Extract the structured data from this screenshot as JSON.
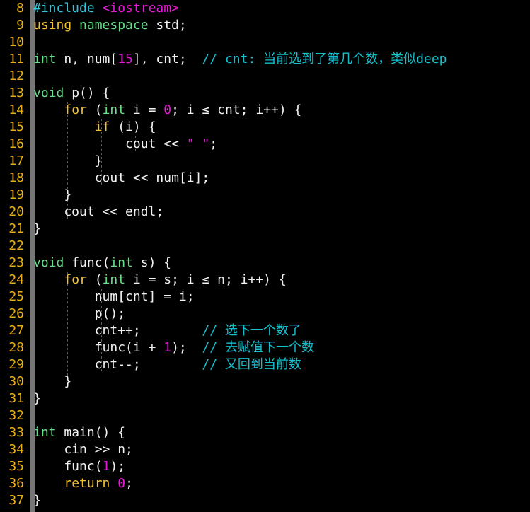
{
  "editor": {
    "language": "cpp",
    "background_color": "#000000",
    "line_number_color": "#e8b012",
    "block_marker_color": "#767676",
    "first_visible_line": 8,
    "last_visible_line": 37,
    "colors": {
      "preprocessor": "#2fc7e0",
      "header": "#e418d6",
      "keyword": "#f2c12e",
      "type": "#66e08c",
      "number": "#e418d6",
      "string": "#e418d6",
      "plain": "#f2f2f2",
      "comment": "#12c0cf"
    }
  },
  "lines": [
    {
      "number": "8",
      "tokens": [
        {
          "t": "#include",
          "c": "tk-pre"
        },
        {
          "t": " ",
          "c": "tk-plain"
        },
        {
          "t": "<iostream>",
          "c": "tk-hdr"
        }
      ],
      "guides": []
    },
    {
      "number": "9",
      "tokens": [
        {
          "t": "using",
          "c": "tk-kw"
        },
        {
          "t": " ",
          "c": "tk-plain"
        },
        {
          "t": "namespace",
          "c": "tk-type"
        },
        {
          "t": " std;",
          "c": "tk-plain"
        }
      ],
      "guides": []
    },
    {
      "number": "10",
      "tokens": [],
      "guides": []
    },
    {
      "number": "11",
      "tokens": [
        {
          "t": "int",
          "c": "tk-type"
        },
        {
          "t": " n, num[",
          "c": "tk-plain"
        },
        {
          "t": "15",
          "c": "tk-num"
        },
        {
          "t": "], cnt;  ",
          "c": "tk-plain"
        },
        {
          "t": "// cnt: 当前选到了第几个数，类似deep",
          "c": "tk-cmt"
        }
      ],
      "guides": []
    },
    {
      "number": "12",
      "tokens": [],
      "guides": []
    },
    {
      "number": "13",
      "tokens": [
        {
          "t": "void",
          "c": "tk-type"
        },
        {
          "t": " p() {",
          "c": "tk-plain"
        }
      ],
      "guides": []
    },
    {
      "number": "14",
      "tokens": [
        {
          "t": "    ",
          "c": "tk-plain"
        },
        {
          "t": "for",
          "c": "tk-kw"
        },
        {
          "t": " (",
          "c": "tk-plain"
        },
        {
          "t": "int",
          "c": "tk-type"
        },
        {
          "t": " i = ",
          "c": "tk-plain"
        },
        {
          "t": "0",
          "c": "tk-num"
        },
        {
          "t": "; i ≤ cnt; i++) {",
          "c": "tk-plain"
        }
      ],
      "guides": [
        95
      ]
    },
    {
      "number": "15",
      "tokens": [
        {
          "t": "        ",
          "c": "tk-plain"
        },
        {
          "t": "if",
          "c": "tk-kw"
        },
        {
          "t": " (i) {",
          "c": "tk-plain"
        }
      ],
      "guides": [
        95,
        143
      ]
    },
    {
      "number": "16",
      "tokens": [
        {
          "t": "            cout << ",
          "c": "tk-plain"
        },
        {
          "t": "\" \"",
          "c": "tk-str"
        },
        {
          "t": ";",
          "c": "tk-plain"
        }
      ],
      "guides": [
        95,
        143,
        191
      ]
    },
    {
      "number": "17",
      "tokens": [
        {
          "t": "        }",
          "c": "tk-plain"
        }
      ],
      "guides": [
        95,
        143
      ]
    },
    {
      "number": "18",
      "tokens": [
        {
          "t": "        cout << num[i];",
          "c": "tk-plain"
        }
      ],
      "guides": [
        95,
        143
      ]
    },
    {
      "number": "19",
      "tokens": [
        {
          "t": "    }",
          "c": "tk-plain"
        }
      ],
      "guides": [
        95
      ]
    },
    {
      "number": "20",
      "tokens": [
        {
          "t": "    cout << endl;",
          "c": "tk-plain"
        }
      ],
      "guides": [
        95
      ]
    },
    {
      "number": "21",
      "tokens": [
        {
          "t": "}",
          "c": "tk-plain"
        }
      ],
      "guides": []
    },
    {
      "number": "22",
      "tokens": [],
      "guides": []
    },
    {
      "number": "23",
      "tokens": [
        {
          "t": "void",
          "c": "tk-type"
        },
        {
          "t": " func(",
          "c": "tk-plain"
        },
        {
          "t": "int",
          "c": "tk-type"
        },
        {
          "t": " s) {",
          "c": "tk-plain"
        }
      ],
      "guides": []
    },
    {
      "number": "24",
      "tokens": [
        {
          "t": "    ",
          "c": "tk-plain"
        },
        {
          "t": "for",
          "c": "tk-kw"
        },
        {
          "t": " (",
          "c": "tk-plain"
        },
        {
          "t": "int",
          "c": "tk-type"
        },
        {
          "t": " i = s; i ≤ n; i++) {",
          "c": "tk-plain"
        }
      ],
      "guides": [
        95
      ]
    },
    {
      "number": "25",
      "tokens": [
        {
          "t": "        num[cnt] = i;",
          "c": "tk-plain"
        }
      ],
      "guides": [
        95,
        143
      ]
    },
    {
      "number": "26",
      "tokens": [
        {
          "t": "        p();",
          "c": "tk-plain"
        }
      ],
      "guides": [
        95,
        143
      ]
    },
    {
      "number": "27",
      "tokens": [
        {
          "t": "        cnt++;        ",
          "c": "tk-plain"
        },
        {
          "t": "// 选下一个数了",
          "c": "tk-cmt"
        }
      ],
      "guides": [
        95,
        143
      ]
    },
    {
      "number": "28",
      "tokens": [
        {
          "t": "        func(i + ",
          "c": "tk-plain"
        },
        {
          "t": "1",
          "c": "tk-num"
        },
        {
          "t": ");  ",
          "c": "tk-plain"
        },
        {
          "t": "// 去赋值下一个数",
          "c": "tk-cmt"
        }
      ],
      "guides": [
        95,
        143
      ]
    },
    {
      "number": "29",
      "tokens": [
        {
          "t": "        cnt--;        ",
          "c": "tk-plain"
        },
        {
          "t": "// 又回到当前数",
          "c": "tk-cmt"
        }
      ],
      "guides": [
        95,
        143
      ]
    },
    {
      "number": "30",
      "tokens": [
        {
          "t": "    }",
          "c": "tk-plain"
        }
      ],
      "guides": [
        95
      ]
    },
    {
      "number": "31",
      "tokens": [
        {
          "t": "}",
          "c": "tk-plain"
        }
      ],
      "guides": []
    },
    {
      "number": "32",
      "tokens": [],
      "guides": []
    },
    {
      "number": "33",
      "tokens": [
        {
          "t": "int",
          "c": "tk-type"
        },
        {
          "t": " main() {",
          "c": "tk-plain"
        }
      ],
      "guides": []
    },
    {
      "number": "34",
      "tokens": [
        {
          "t": "    cin >> n;",
          "c": "tk-plain"
        }
      ],
      "guides": []
    },
    {
      "number": "35",
      "tokens": [
        {
          "t": "    func(",
          "c": "tk-plain"
        },
        {
          "t": "1",
          "c": "tk-num"
        },
        {
          "t": ");",
          "c": "tk-plain"
        }
      ],
      "guides": []
    },
    {
      "number": "36",
      "tokens": [
        {
          "t": "    ",
          "c": "tk-plain"
        },
        {
          "t": "return",
          "c": "tk-kw"
        },
        {
          "t": " ",
          "c": "tk-plain"
        },
        {
          "t": "0",
          "c": "tk-num"
        },
        {
          "t": ";",
          "c": "tk-plain"
        }
      ],
      "guides": []
    },
    {
      "number": "37",
      "tokens": [
        {
          "t": "}",
          "c": "tk-plain"
        }
      ],
      "guides": []
    }
  ]
}
